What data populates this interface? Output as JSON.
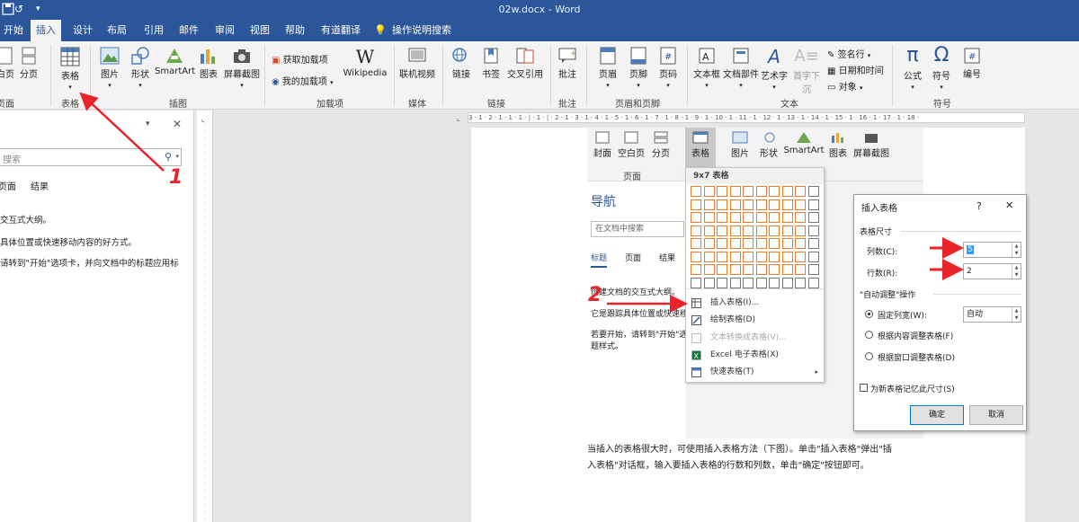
{
  "titlebar": {
    "title": "02w.docx  -  Word",
    "save_icon": "save-icon",
    "undo_icon": "undo-icon",
    "more": "▾"
  },
  "tabs": [
    "开始",
    "插入",
    "设计",
    "布局",
    "引用",
    "邮件",
    "审阅",
    "视图",
    "帮助",
    "有道翻译",
    "操作说明搜索"
  ],
  "ribbon": {
    "page_group": {
      "blank_page": "白页",
      "page_break": "分页",
      "label": "页面"
    },
    "table": {
      "label": "表格",
      "group": "表格"
    },
    "illustrations": {
      "picture": "图片",
      "shapes": "形状",
      "smartart": "SmartArt",
      "chart": "图表",
      "screenshot": "屏幕截图",
      "group": "插图"
    },
    "addins": {
      "get": "获取加载项",
      "mine": "我的加载项",
      "wiki": "Wikipedia",
      "group": "加载项"
    },
    "media": {
      "video": "联机视频",
      "group": "媒体"
    },
    "links": {
      "link": "链接",
      "bookmark": "书签",
      "crossref": "交叉引用",
      "group": "链接"
    },
    "comments": {
      "comment": "批注",
      "group": "批注"
    },
    "header_footer": {
      "header": "页眉",
      "footer": "页脚",
      "page_number": "页码",
      "group": "页眉和页脚"
    },
    "text": {
      "textbox": "文本框",
      "parts": "文档部件",
      "wordart": "艺术字",
      "dropcap": "首字下沉",
      "signature": "签名行",
      "datetime": "日期和时间",
      "object": "对象",
      "group": "文本"
    },
    "symbols": {
      "equation": "公式",
      "symbol": "符号",
      "number": "编号",
      "group": "符号"
    }
  },
  "navpane": {
    "search_placeholder": "搜索",
    "tabs": [
      "页面",
      "结果"
    ],
    "lines": [
      "交互式大纲。",
      "具体位置或快速移动内容的好方式。",
      "请转到\"开始\"选项卡，并向文档中的标题应用标"
    ]
  },
  "ruler": "3 · 1 · 2 · 1 · 1 · 1 · | · 1 · | · 2 · 1 · 3 · 1 · 4 · 1 · 5 · 1 · 6 · 1 · 7 · 1 · 8 · 1 · 9 · 1 · 10 · 1 · 11 · 1 · 12 · 1 · 13 · 1 · 14 · 1 · 15 · 1 · 16 · 1 · 17 · 1 · 18 ·",
  "embed": {
    "cover": "封面",
    "blank": "空白页",
    "break": "分页",
    "page_label": "页面",
    "table": "表格",
    "picture": "图片",
    "shapes": "形状",
    "smartart": "SmartArt",
    "chart": "图表",
    "screenshot": "屏幕截图",
    "nav_title": "导航",
    "nav_search": "在文档中搜索",
    "nav_tabs": [
      "标题",
      "页面",
      "结果"
    ],
    "nav_lines": [
      "创建文档的交互式大纲。",
      "它是跟踪具体位置或快速移",
      "若要开始，请转到\"开始\"选",
      "题样式。"
    ]
  },
  "table_menu": {
    "header": "9x7 表格",
    "cols_total": 10,
    "rows_total": 8,
    "cols_selected": 9,
    "rows_selected": 7,
    "items": [
      "插入表格(I)...",
      "绘制表格(D)",
      "文本转换成表格(V)...",
      "Excel 电子表格(X)",
      "快速表格(T)"
    ]
  },
  "dialog": {
    "title": "插入表格",
    "help": "?",
    "close": "✕",
    "size_section": "表格尺寸",
    "cols_label": "列数(C):",
    "cols_value": "5",
    "rows_label": "行数(R):",
    "rows_value": "2",
    "auto_section": "\"自动调整\"操作",
    "fixed": "固定列宽(W):",
    "fixed_value": "自动",
    "fit_content": "根据内容调整表格(F)",
    "fit_window": "根据窗口调整表格(D)",
    "remember": "为新表格记忆此尺寸(S)",
    "ok": "确定",
    "cancel": "取消"
  },
  "annotations": {
    "step1": "1",
    "step2": "2"
  },
  "body_text": [
    "当插入的表格很大时，可使用插入表格方法（下图）。单击\"插入表格\"弹出\"插",
    "入表格\"对话框，输入要插入表格的行数和列数，单击\"确定\"按钮即可。"
  ],
  "colors": {
    "accent": "#2b579a",
    "arrow": "#e8232a",
    "grid_select": "#f07b2a"
  }
}
